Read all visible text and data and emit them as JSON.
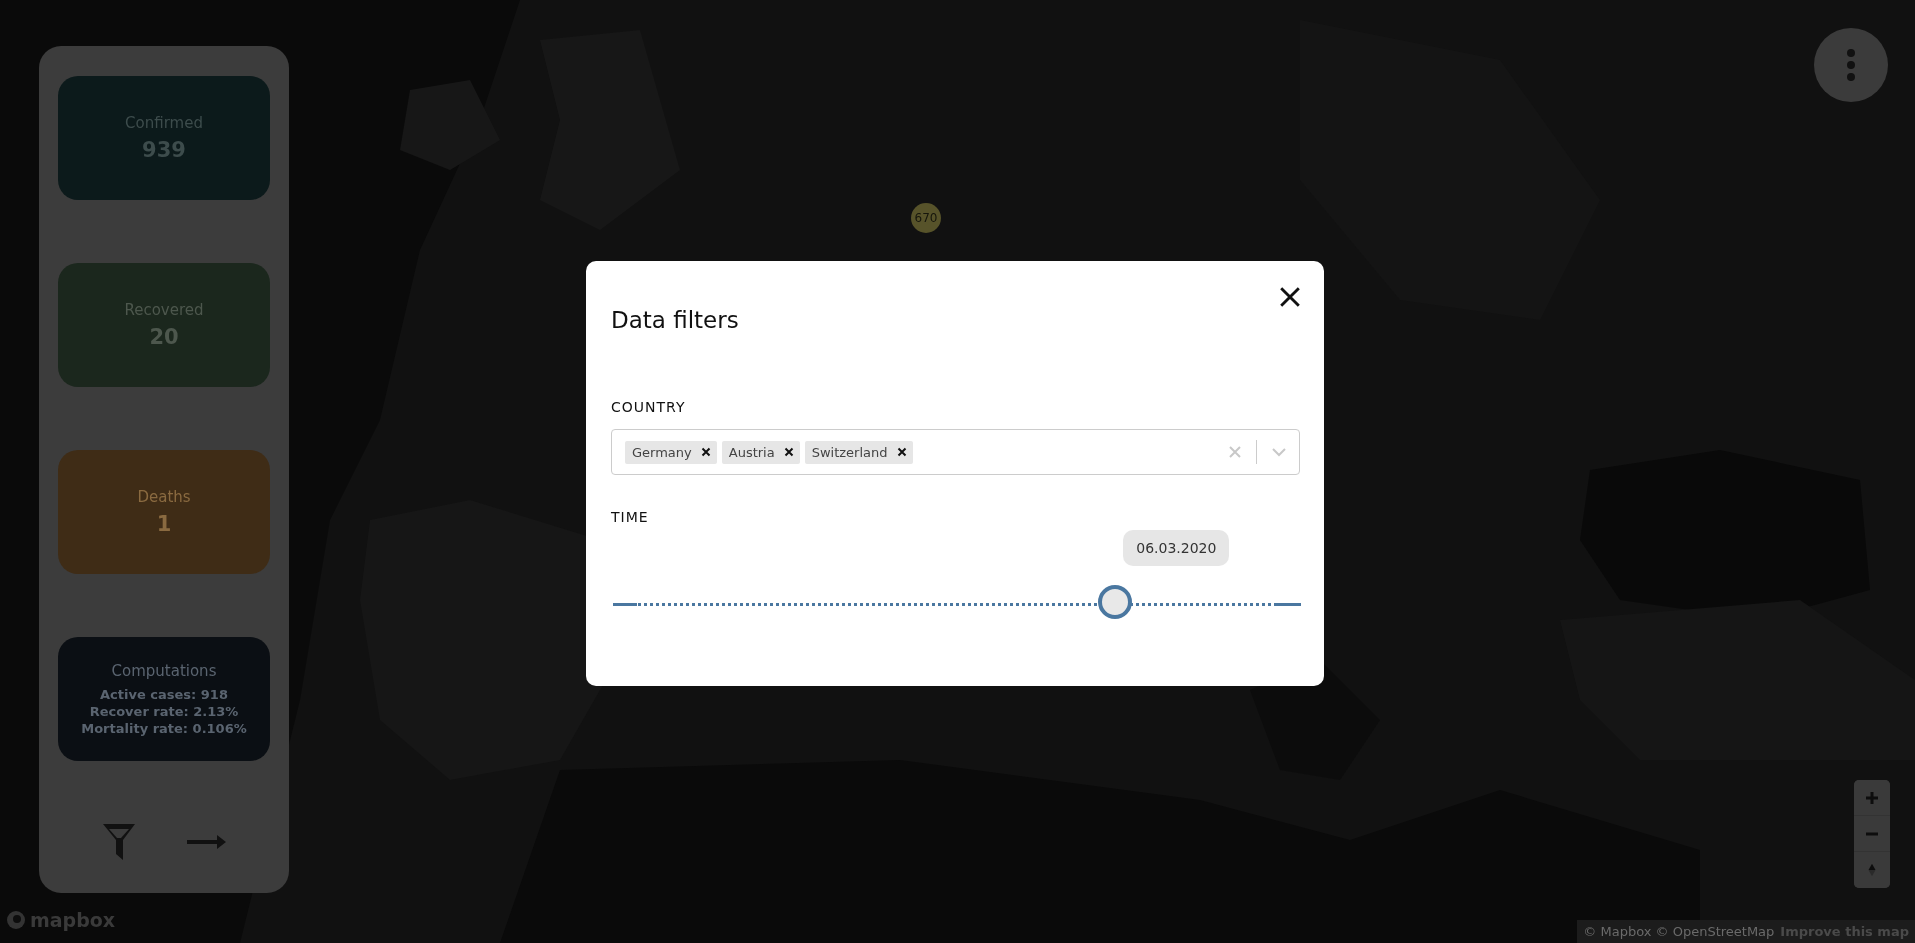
{
  "sidebar": {
    "cards": [
      {
        "kind": "stat",
        "title": "Confirmed",
        "value": "939",
        "color": "#0c1a1b"
      },
      {
        "kind": "stat",
        "title": "Recovered",
        "value": "20",
        "color": "#1b271d"
      },
      {
        "kind": "stat",
        "title": "Deaths",
        "value": "1",
        "color": "#3f2c16"
      },
      {
        "kind": "summary",
        "title": "Computations",
        "lines": [
          "Active cases: 918",
          "Recover rate: 2.13%",
          "Mortality rate: 0.106%"
        ],
        "color": "#0b0f14"
      }
    ]
  },
  "map": {
    "cluster_label": "670",
    "logo": "mapbox",
    "attribution": "© Mapbox © OpenStreetMap",
    "improve_link": "Improve this map"
  },
  "modal": {
    "title": "Data filters",
    "country": {
      "label": "COUNTRY",
      "tags": [
        "Germany",
        "Austria",
        "Switzerland"
      ]
    },
    "time": {
      "label": "TIME",
      "value": "06.03.2020",
      "level": 0.73
    }
  }
}
